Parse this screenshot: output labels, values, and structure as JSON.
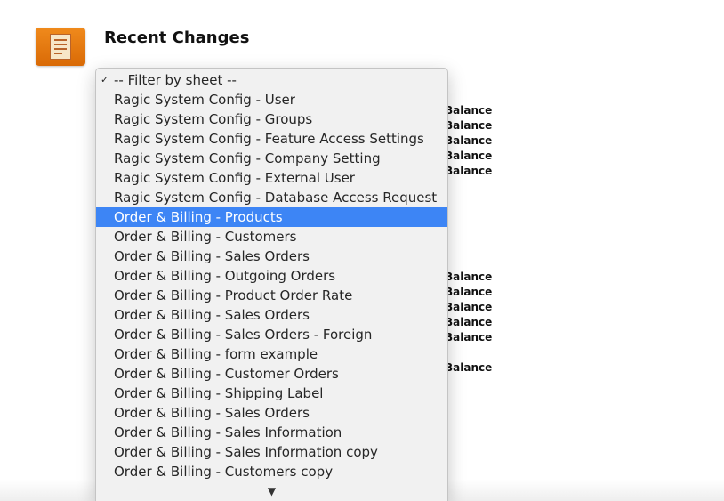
{
  "header": {
    "title": "Recent Changes",
    "icon": "sheet-document-icon",
    "icon_color": "#e8780f"
  },
  "background_items": [
    "Balance",
    "Balance",
    "Balance",
    "Balance",
    "Balance",
    "Balance",
    "Balance",
    "Balance",
    "Balance",
    "Balance",
    "Balance"
  ],
  "dropdown": {
    "selected_index": 7,
    "highlight_color": "#3d85f5",
    "items": [
      "-- Filter by sheet --",
      "Ragic System Config - User",
      "Ragic System Config - Groups",
      "Ragic System Config - Feature Access Settings",
      "Ragic System Config - Company Setting",
      "Ragic System Config - External User",
      "Ragic System Config - Database Access Request",
      "Order & Billing - Products",
      "Order & Billing - Customers",
      "Order & Billing - Sales Orders",
      "Order & Billing - Outgoing Orders",
      "Order & Billing - Product Order Rate",
      "Order & Billing - Sales Orders",
      "Order & Billing - Sales Orders - Foreign",
      "Order & Billing - form example",
      "Order & Billing - Customer Orders",
      "Order & Billing - Shipping Label",
      "Order & Billing - Sales Orders",
      "Order & Billing - Sales Information",
      "Order & Billing - Sales Information copy",
      "Order & Billing - Customers copy"
    ],
    "check_glyph": "✓",
    "more_glyph": "▼"
  }
}
